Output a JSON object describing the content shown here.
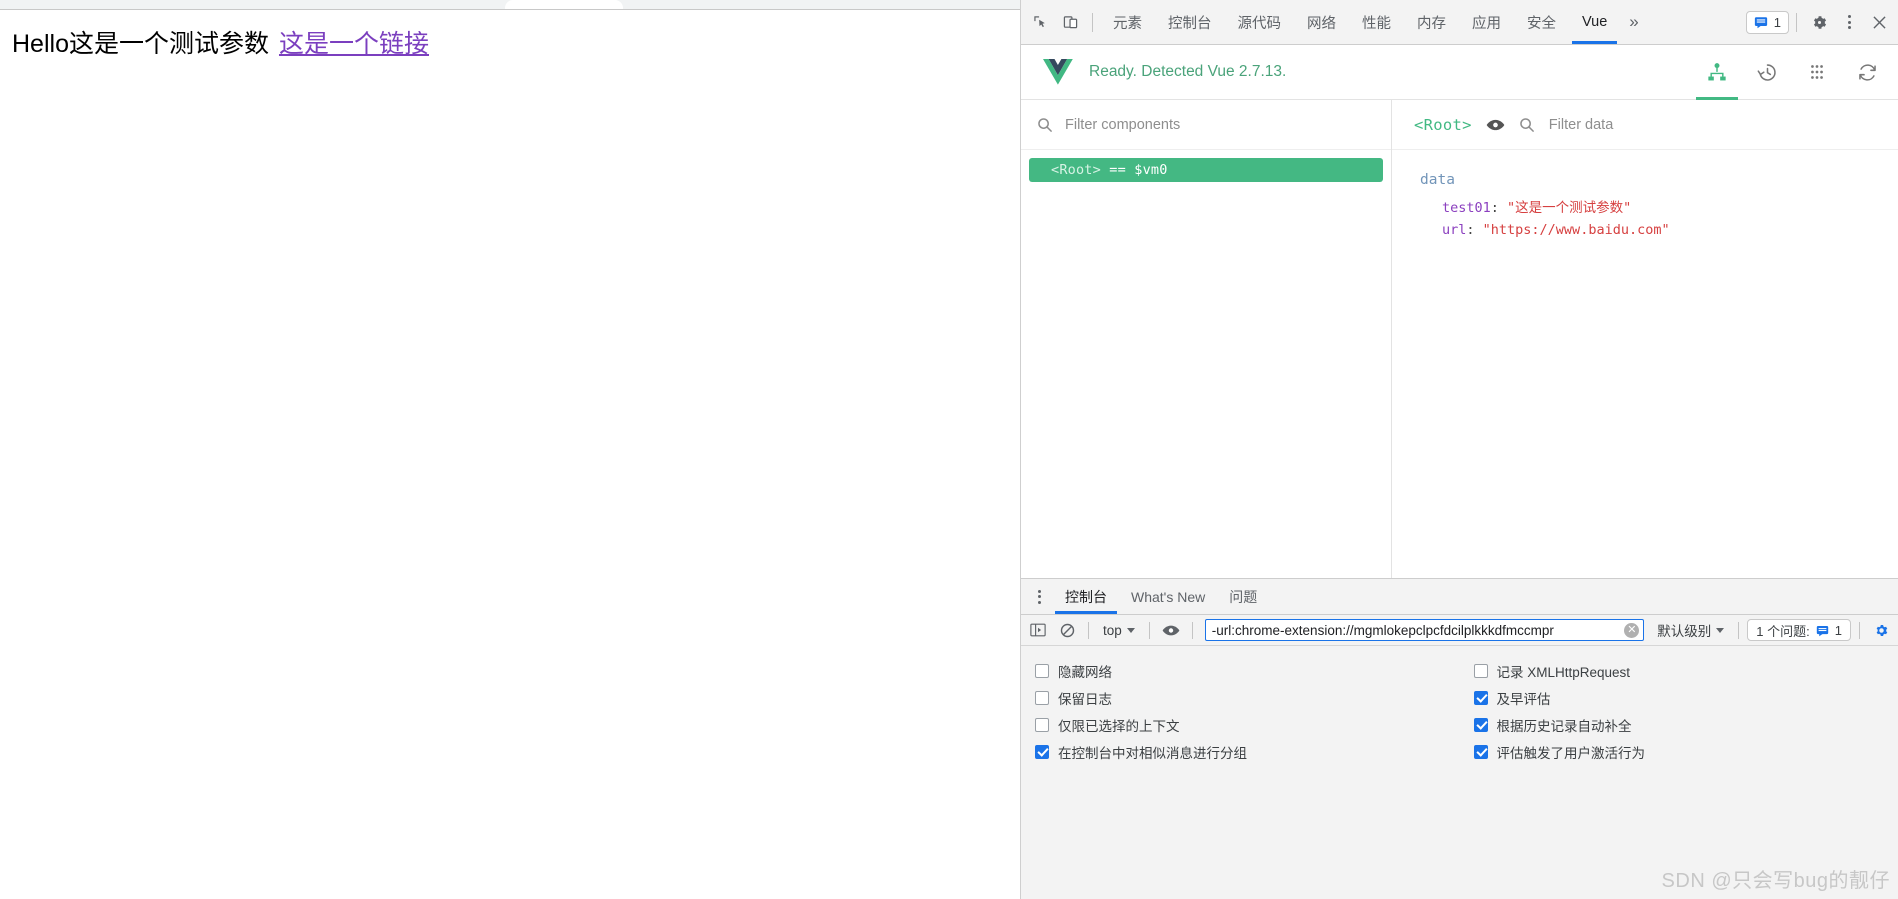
{
  "page": {
    "heading_plain": "Hello这是一个测试参数",
    "heading_link": "这是一个链接"
  },
  "devtools": {
    "toolbar": {
      "inspect_icon": "inspect-element-icon",
      "device_icon": "device-toolbar-icon",
      "tabs": [
        {
          "label": "元素",
          "active": false
        },
        {
          "label": "控制台",
          "active": false
        },
        {
          "label": "源代码",
          "active": false
        },
        {
          "label": "网络",
          "active": false
        },
        {
          "label": "性能",
          "active": false
        },
        {
          "label": "内存",
          "active": false
        },
        {
          "label": "应用",
          "active": false
        },
        {
          "label": "安全",
          "active": false
        },
        {
          "label": "Vue",
          "active": true
        }
      ],
      "more_tabs": "»",
      "issue_count": "1",
      "settings_icon": "gear-icon",
      "kebab_icon": "more-options-icon",
      "close_icon": "close-icon"
    },
    "vue": {
      "status": "Ready. Detected Vue 2.7.13.",
      "logo": "vue-logo-icon",
      "header_buttons": [
        {
          "name": "components-tab-icon",
          "active": true
        },
        {
          "name": "timeline-history-icon",
          "active": false
        },
        {
          "name": "settings-dots-icon",
          "active": false
        },
        {
          "name": "refresh-icon",
          "active": false
        }
      ],
      "filter_components_placeholder": "Filter components",
      "tree": [
        {
          "tag": "<Root>",
          "alias": "== $vm0",
          "selected": true
        }
      ],
      "inspector": {
        "component_name": "<Root>",
        "eye_icon": "eye-icon",
        "search_icon": "search-icon",
        "filter_data_placeholder": "Filter data",
        "group_title": "data",
        "entries": [
          {
            "key": "test01",
            "sep": ": ",
            "value": "\"这是一个测试参数\""
          },
          {
            "key": "url",
            "sep": ": ",
            "value": "\"https://www.baidu.com\""
          }
        ]
      }
    },
    "drawer": {
      "kebab_icon": "drawer-more-icon",
      "tabs": [
        {
          "label": "控制台",
          "active": true
        },
        {
          "label": "What's New",
          "active": false
        },
        {
          "label": "问题",
          "active": false
        }
      ],
      "console_toolbar": {
        "sidebar_icon": "console-sidebar-icon",
        "clear_icon": "clear-console-icon",
        "context_value": "top",
        "eye_icon": "live-expression-icon",
        "filter_value": "-url:chrome-extension://mgmlokepclpcfdcilplkkkdfmccmpr",
        "clear_filter_icon": "clear-input-icon",
        "level_value": "默认级别",
        "issues_label": "1 个问题:",
        "issues_count": "1",
        "settings_icon": "console-settings-icon"
      },
      "settings_left": [
        {
          "label": "隐藏网络",
          "checked": false
        },
        {
          "label": "保留日志",
          "checked": false
        },
        {
          "label": "仅限已选择的上下文",
          "checked": false
        },
        {
          "label": "在控制台中对相似消息进行分组",
          "checked": true
        }
      ],
      "settings_right": [
        {
          "label": "记录 XMLHttpRequest",
          "checked": false
        },
        {
          "label": "及早评估",
          "checked": true
        },
        {
          "label": "根据历史记录自动补全",
          "checked": true
        },
        {
          "label": "评估触发了用户激活行为",
          "checked": true
        }
      ],
      "watermark": "SDN @只会写bug的靓仔"
    }
  },
  "colors": {
    "accent_blue": "#1a73e8",
    "vue_green": "#42b983",
    "link_purple": "#7b3fbf",
    "string_red": "#d64040",
    "key_purple": "#8b3fbf"
  }
}
